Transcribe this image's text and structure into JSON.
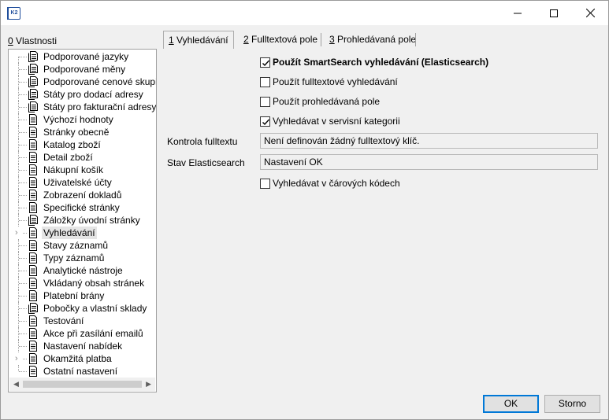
{
  "titlebar": {
    "app_icon_text": "K2",
    "minimize": "minimize",
    "maximize": "maximize",
    "close": "close"
  },
  "left_panel": {
    "accel": "0",
    "label": " Vlastnosti",
    "items": [
      {
        "label": "Podporované jazyky",
        "icon": "multi-doc-icon",
        "expander": false
      },
      {
        "label": "Podporované měny",
        "icon": "multi-doc-icon",
        "expander": false
      },
      {
        "label": "Podporované cenové skupiny",
        "icon": "multi-doc-icon",
        "expander": false
      },
      {
        "label": "Státy pro dodací adresy",
        "icon": "multi-doc-icon",
        "expander": false
      },
      {
        "label": "Státy pro fakturační adresy",
        "icon": "multi-doc-icon",
        "expander": false
      },
      {
        "label": "Výchozí hodnoty",
        "icon": "doc-icon",
        "expander": false
      },
      {
        "label": "Stránky obecně",
        "icon": "doc-icon",
        "expander": false
      },
      {
        "label": "Katalog zboží",
        "icon": "doc-icon",
        "expander": false
      },
      {
        "label": "Detail zboží",
        "icon": "doc-icon",
        "expander": false
      },
      {
        "label": "Nákupní košík",
        "icon": "doc-icon",
        "expander": false
      },
      {
        "label": "Uživatelské účty",
        "icon": "doc-icon",
        "expander": false
      },
      {
        "label": "Zobrazení dokladů",
        "icon": "doc-icon",
        "expander": false
      },
      {
        "label": "Specifické stránky",
        "icon": "doc-icon",
        "expander": false
      },
      {
        "label": "Záložky úvodní stránky",
        "icon": "multi-doc-icon",
        "expander": false
      },
      {
        "label": "Vyhledávání",
        "icon": "doc-icon",
        "expander": true,
        "selected": true
      },
      {
        "label": "Stavy záznamů",
        "icon": "doc-icon",
        "expander": false
      },
      {
        "label": "Typy záznamů",
        "icon": "doc-icon",
        "expander": false
      },
      {
        "label": "Analytické nástroje",
        "icon": "doc-icon",
        "expander": false
      },
      {
        "label": "Vkládaný obsah stránek",
        "icon": "doc-icon",
        "expander": false
      },
      {
        "label": "Platební brány",
        "icon": "doc-icon",
        "expander": false
      },
      {
        "label": "Pobočky a vlastní sklady",
        "icon": "multi-doc-icon",
        "expander": false
      },
      {
        "label": "Testování",
        "icon": "doc-icon",
        "expander": false
      },
      {
        "label": "Akce při zasílání emailů",
        "icon": "doc-icon",
        "expander": false
      },
      {
        "label": "Nastavení nabídek",
        "icon": "doc-icon",
        "expander": false
      },
      {
        "label": "Okamžitá platba",
        "icon": "doc-icon",
        "expander": true
      },
      {
        "label": "Ostatní nastavení",
        "icon": "doc-icon",
        "expander": false
      }
    ]
  },
  "tabs": [
    {
      "accel": "1",
      "label": " Vyhledávání",
      "active": true
    },
    {
      "accel": "2",
      "label": " Fulltextová pole",
      "active": false
    },
    {
      "accel": "3",
      "label": " Prohledávaná pole",
      "active": false
    }
  ],
  "options": {
    "smartsearch": {
      "label": "Použít SmartSearch vyhledávání (Elasticsearch)",
      "checked": true
    },
    "fulltext": {
      "label": "Použít fulltextové vyhledávání",
      "checked": false
    },
    "searched_fields": {
      "label": "Použít prohledávaná pole",
      "checked": false
    },
    "service_category": {
      "label": "Vyhledávat v servisní kategorii",
      "checked": true
    },
    "barcodes": {
      "label": "Vyhledávat v čárových kódech",
      "checked": false
    }
  },
  "fields": {
    "fulltext_check": {
      "label": "Kontrola fulltextu",
      "value": "Není definován žádný fulltextový klíč."
    },
    "elastic_state": {
      "label": "Stav Elasticsearch",
      "value": "Nastavení OK"
    }
  },
  "buttons": {
    "ok": "OK",
    "cancel": "Storno"
  },
  "colors": {
    "default_button_border": "#0078d7",
    "window_bg": "#f0f0f0"
  }
}
